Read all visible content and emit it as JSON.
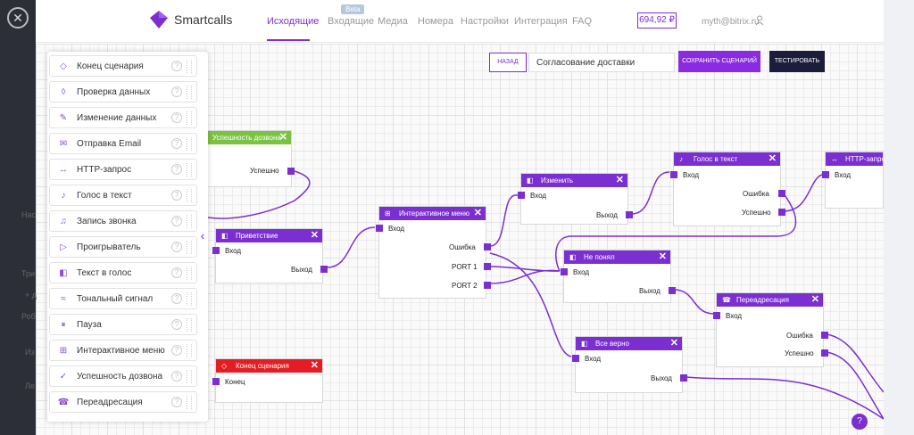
{
  "header": {
    "brand": "Smartcalls",
    "nav": [
      "Исходящие",
      "Входящие",
      "Медиа",
      "Номера",
      "Настройки",
      "Интеграция",
      "FAQ"
    ],
    "beta_badge": "Beta",
    "balance": "694,92 ₽",
    "email": "myth@bitrix.ru"
  },
  "toolbar": {
    "back_label": "НАЗАД",
    "scenario_name": "Согласование доставки",
    "save_label": "СОХРАНИТЬ СЦЕНАРИЙ",
    "test_label": "ТЕСТИРОВАТЬ"
  },
  "sidebar": {
    "items": [
      {
        "label": "Конец сценария",
        "icon": "end-icon"
      },
      {
        "label": "Проверка данных",
        "icon": "check-data-icon"
      },
      {
        "label": "Изменение данных",
        "icon": "edit-icon"
      },
      {
        "label": "Отправка Email",
        "icon": "mail-icon"
      },
      {
        "label": "HTTP-запрос",
        "icon": "http-icon"
      },
      {
        "label": "Голос в текст",
        "icon": "microphone-icon"
      },
      {
        "label": "Запись звонка",
        "icon": "bell-icon"
      },
      {
        "label": "Проигрыватель",
        "icon": "play-icon"
      },
      {
        "label": "Текст в голос",
        "icon": "speaker-icon"
      },
      {
        "label": "Тональный сигнал",
        "icon": "tone-icon"
      },
      {
        "label": "Пауза",
        "icon": "pause-icon"
      },
      {
        "label": "Интерактивное меню",
        "icon": "menu-icon"
      },
      {
        "label": "Успешность дозвона",
        "icon": "success-icon"
      },
      {
        "label": "Переадресация",
        "icon": "redirect-icon"
      }
    ],
    "help_glyph": "?"
  },
  "behind_text": [
    "Нас",
    "Три",
    "+ д",
    "Роб",
    "Из",
    "Ле"
  ],
  "nodes": {
    "success_call": {
      "title": "Успешность дозвона",
      "out": "Успешно"
    },
    "greeting": {
      "title": "Приветствие",
      "in": "Вход",
      "out": "Выход"
    },
    "end": {
      "title": "Конец сценария",
      "in": "Конец"
    },
    "menu": {
      "title": "Интерактивное меню",
      "in": "Вход",
      "outs": [
        "Ошибка",
        "PORT 1",
        "PORT 2"
      ]
    },
    "change": {
      "title": "Изменить",
      "in": "Вход",
      "out": "Выход"
    },
    "not_understood": {
      "title": "Не понял",
      "in": "Вход",
      "out": "Выход"
    },
    "correct": {
      "title": "Все верно",
      "in": "Вход",
      "out": "Выход"
    },
    "voice_text": {
      "title": "Голос в текст",
      "in": "Вход",
      "outs": [
        "Ошибка",
        "Успешно"
      ]
    },
    "http": {
      "title": "HTTP-запрос",
      "in": "Вход"
    },
    "redirect": {
      "title": "Переадресация",
      "in": "Вход",
      "outs": [
        "Ошибка",
        "Успешно"
      ]
    }
  },
  "close_glyph": "✕",
  "node_close_glyph": "✕",
  "help_bottom": "?",
  "colors": {
    "accent": "#7b2fd0",
    "end_node": "#e31d23",
    "success_node": "#7cc242"
  }
}
